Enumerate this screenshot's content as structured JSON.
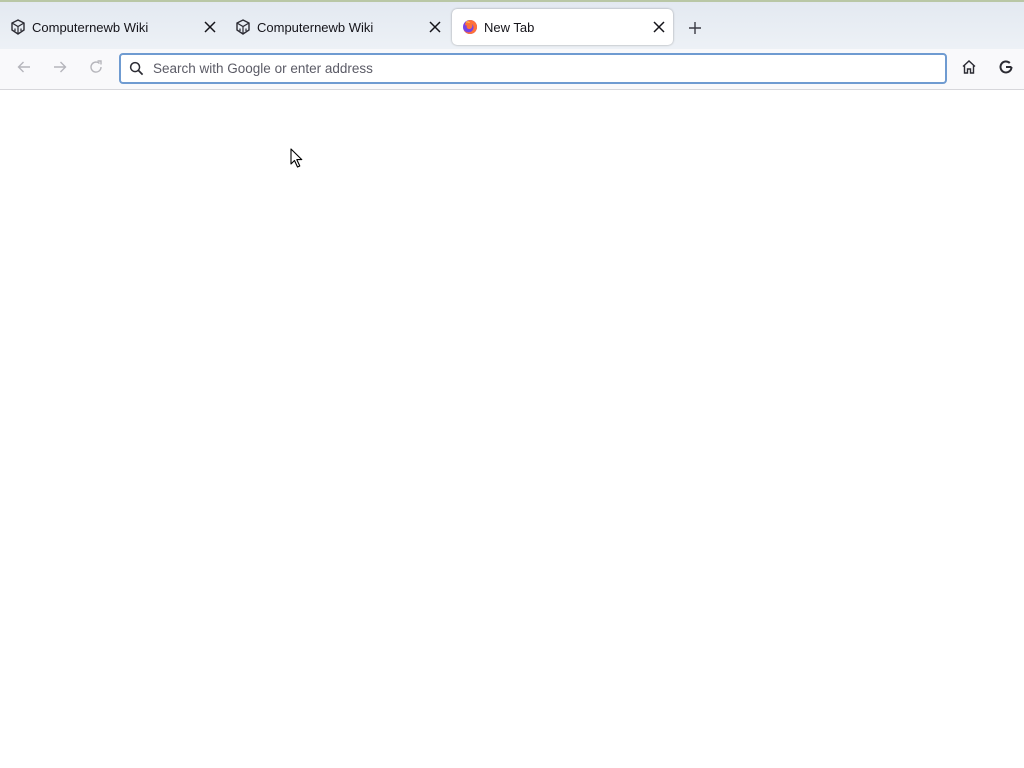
{
  "tabs": [
    {
      "label": "Computernewb Wiki",
      "icon": "wiki-logo-icon",
      "active": false
    },
    {
      "label": "Computernewb Wiki",
      "icon": "wiki-logo-icon",
      "active": false
    },
    {
      "label": "New Tab",
      "icon": "firefox-logo-icon",
      "active": true
    }
  ],
  "navbar": {
    "search_placeholder": "Search with Google or enter address",
    "search_value": ""
  },
  "colors": {
    "urlbar_focus": "#6f9bd1",
    "tabstrip_bg": "#e6ebf2",
    "firefox_orange": "#ff7139",
    "firefox_purple": "#7542e5"
  }
}
